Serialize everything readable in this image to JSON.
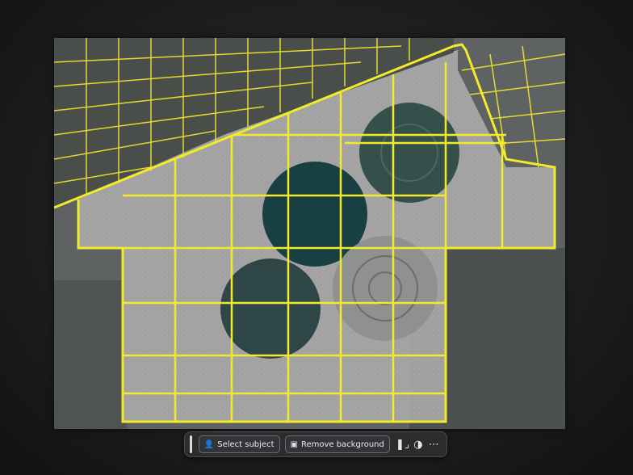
{
  "toolbar": {
    "select_subject_label": "Select subject",
    "remove_background_label": "Remove background",
    "crop_icon": "crop-icon",
    "adjust_icon": "adjust-icon",
    "more_icon": "more-icon"
  },
  "colors": {
    "parcel_line": "#f2ea2a",
    "field_dark": "#173f3f",
    "field_light": "#b9b9b6"
  }
}
